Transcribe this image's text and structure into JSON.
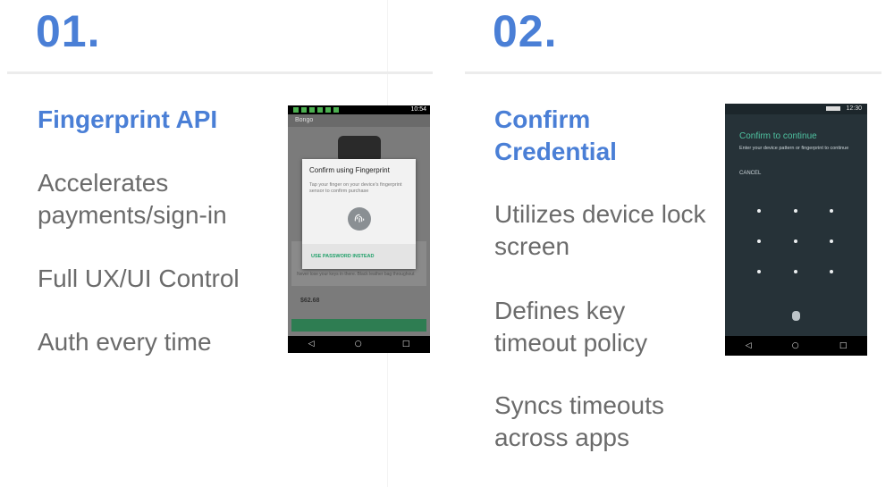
{
  "columns": [
    {
      "number": "01.",
      "heading": "Fingerprint API",
      "bullets": [
        "Accelerates payments/sign-in",
        "Full UX/UI Control",
        "Auth every time"
      ]
    },
    {
      "number": "02.",
      "heading": "Confirm Credential",
      "bullets": [
        "Utilizes device lock screen",
        "Defines key timeout policy",
        "Syncs timeouts across apps"
      ]
    }
  ],
  "phone1": {
    "time": "10:54",
    "app_name": "Bongo",
    "dialog_title": "Confirm using Fingerprint",
    "dialog_body": "Tap your finger on your device's fingerprint sensor to confirm purchase",
    "use_password": "USE PASSWORD INSTEAD",
    "card_text": "Never lose your keys in there. Black leather bag throughout",
    "price": "$62.68",
    "buy_button": "Purchase",
    "icons": [
      "fingerprint-icon",
      "back-icon",
      "home-icon",
      "recents-icon"
    ]
  },
  "phone2": {
    "time": "12:30",
    "title": "Confirm to continue",
    "subtitle": "Enter your device pattern or fingerprint to continue",
    "cancel": "CANCEL",
    "icons": [
      "pattern-dot-icon",
      "fingerprint-icon",
      "back-icon",
      "home-icon",
      "recents-icon"
    ]
  },
  "colors": {
    "accent": "#4a7fd6",
    "body_text": "#6b6b6b",
    "confirm_green": "#4fc3a1"
  }
}
